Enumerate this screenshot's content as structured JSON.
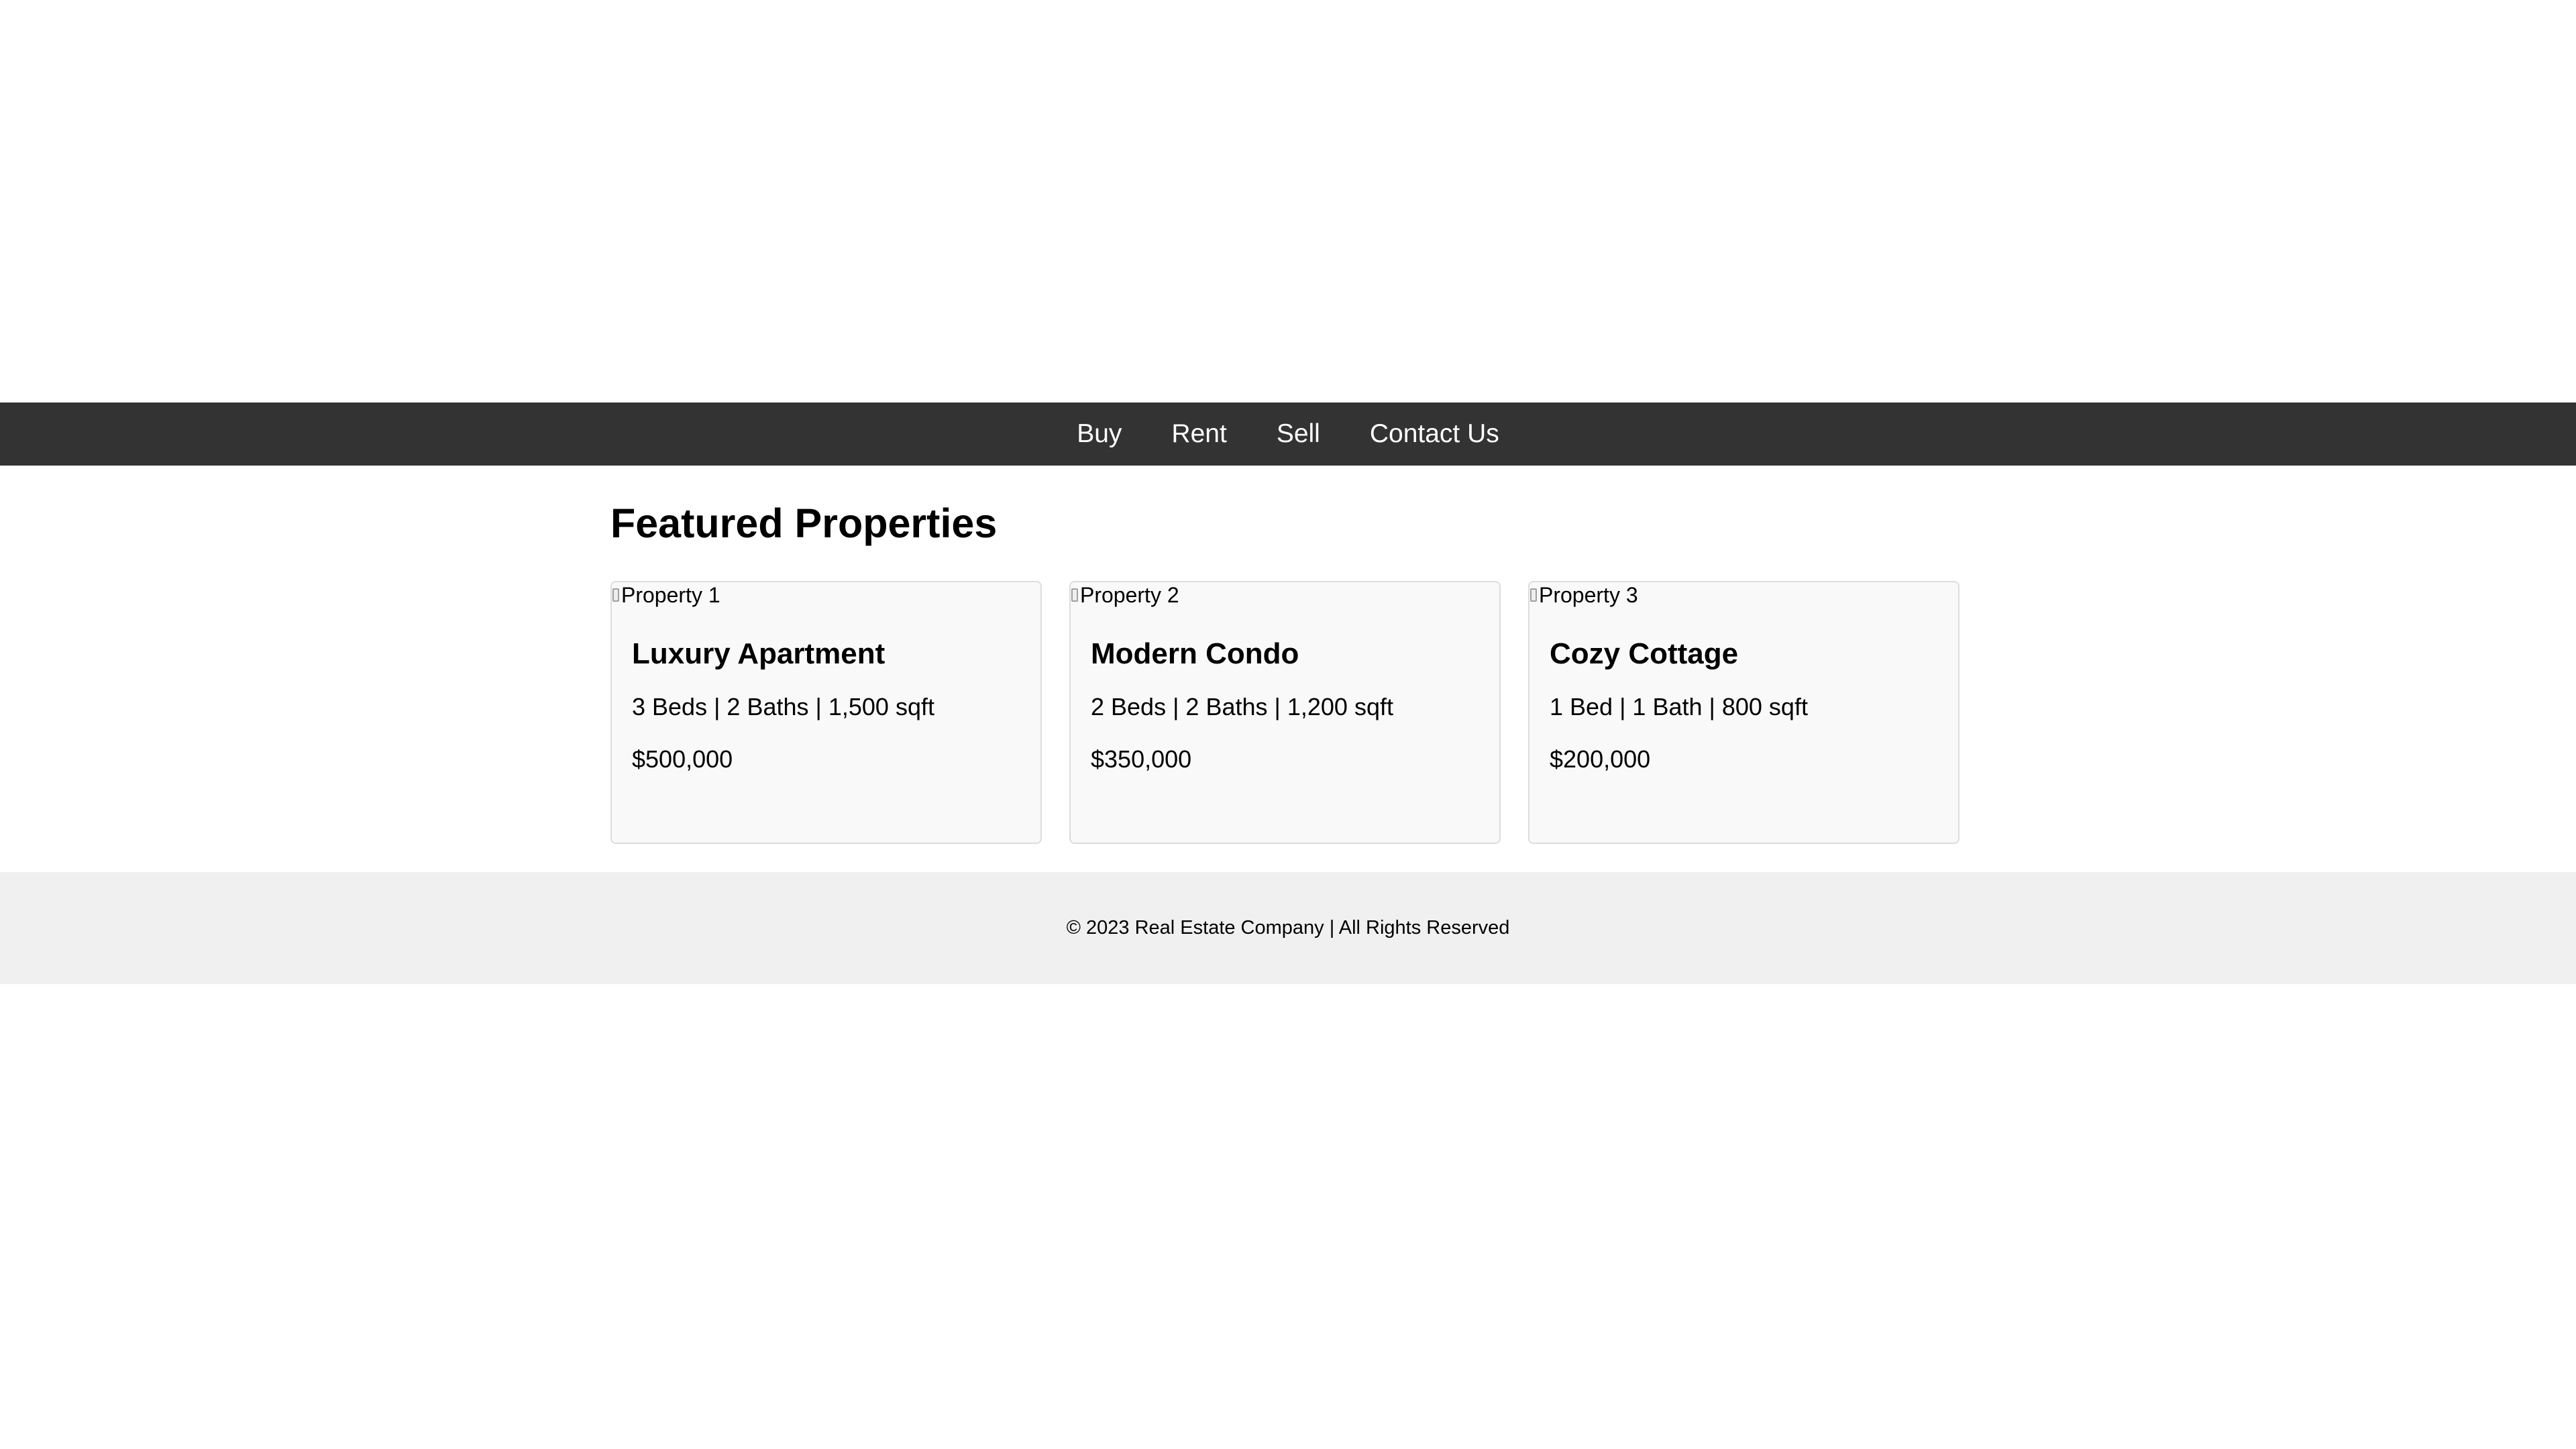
{
  "nav": {
    "items": [
      {
        "label": "Buy"
      },
      {
        "label": "Rent"
      },
      {
        "label": "Sell"
      },
      {
        "label": "Contact Us"
      }
    ]
  },
  "main": {
    "title": "Featured Properties",
    "properties": [
      {
        "image_alt": "Property 1",
        "title": "Luxury Apartment",
        "details": "3 Beds | 2 Baths | 1,500 sqft",
        "price": "$500,000"
      },
      {
        "image_alt": "Property 2",
        "title": "Modern Condo",
        "details": "2 Beds | 2 Baths | 1,200 sqft",
        "price": "$350,000"
      },
      {
        "image_alt": "Property 3",
        "title": "Cozy Cottage",
        "details": "1 Bed | 1 Bath | 800 sqft",
        "price": "$200,000"
      }
    ]
  },
  "footer": {
    "text": "© 2023 Real Estate Company | All Rights Reserved"
  },
  "colors": {
    "nav_background": "#333333",
    "nav_text": "#ffffff",
    "card_background": "#f9f9f9",
    "card_border": "#dddddd",
    "footer_background": "#f0f0f0"
  },
  "icons": {
    "image_placeholder": "broken-image-icon"
  }
}
